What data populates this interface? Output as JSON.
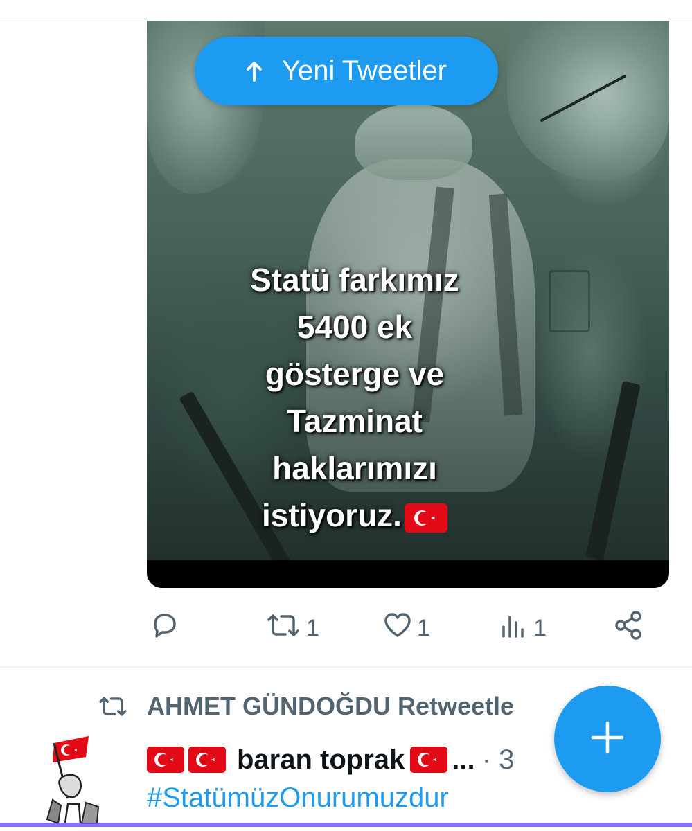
{
  "notice": {
    "new_tweets_label": "Yeni Tweetler"
  },
  "tweet": {
    "image_text_lines": [
      "Statü farkımız",
      "5400 ek",
      "gösterge ve",
      "Tazminat",
      "haklarımızı",
      "istiyoruz."
    ],
    "actions": {
      "reply_count": "",
      "retweet_count": "1",
      "like_count": "1",
      "views_count": "1"
    }
  },
  "next_tweet": {
    "retweeted_by": "AHMET GÜNDOĞDU Retweetle",
    "author_name": "baran toprak",
    "author_ellipsis": "...",
    "time_fragment": "· 3",
    "hashtag": "#StatümüzOnurumuzdur"
  },
  "colors": {
    "accent": "#1d9bf0",
    "muted": "#536471",
    "flag_red": "#e30a17"
  },
  "icons": [
    "arrow-up-icon",
    "reply-icon",
    "retweet-icon",
    "like-icon",
    "views-icon",
    "share-icon",
    "plus-icon",
    "turkish-flag-icon"
  ]
}
